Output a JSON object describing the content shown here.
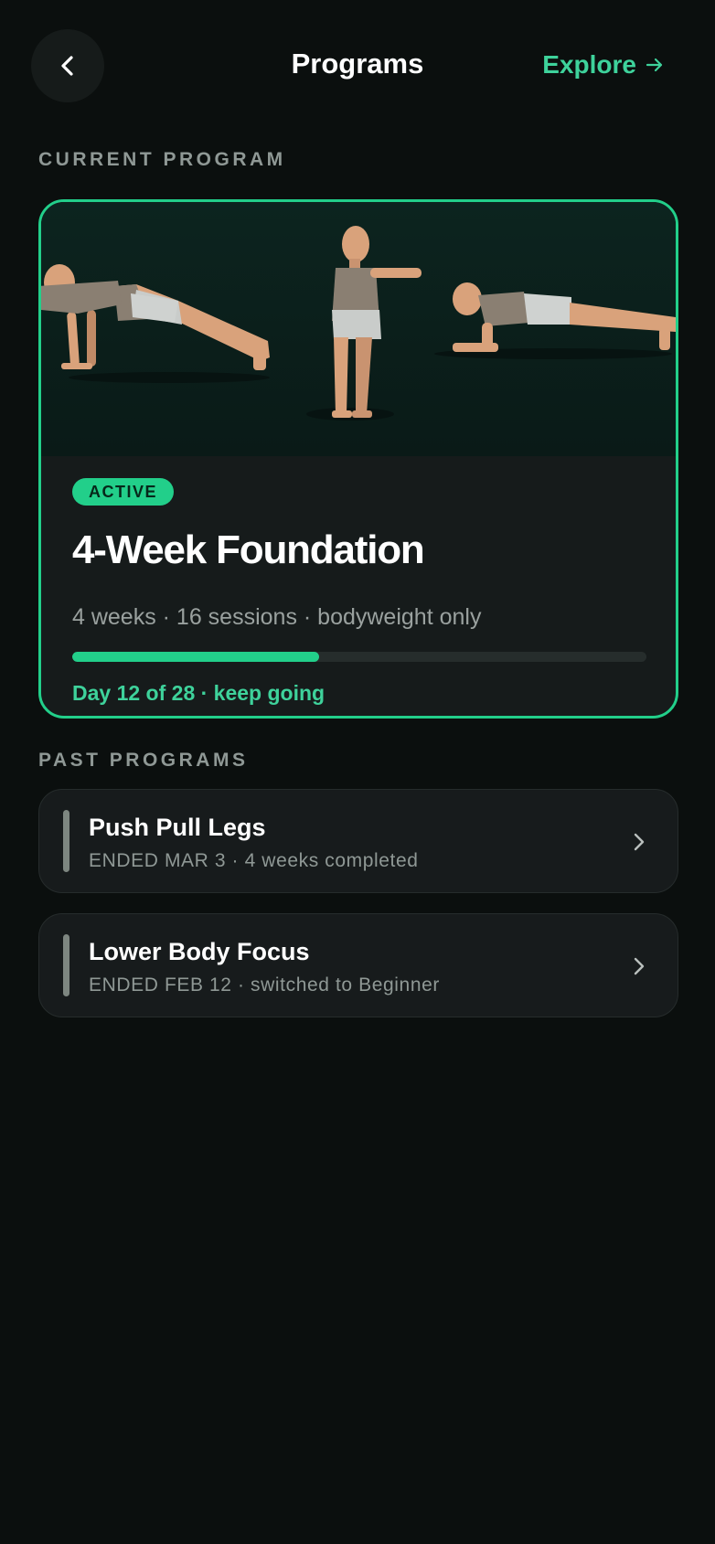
{
  "header": {
    "back_icon": "chevron-left-icon",
    "title": "Programs",
    "explore_label": "Explore",
    "explore_icon": "arrow-right-icon"
  },
  "current_section": {
    "label": "CURRENT PROGRAM",
    "program": {
      "badge": "ACTIVE",
      "name": "4-Week Foundation",
      "meta": "4 weeks · 16 sessions · bodyweight only",
      "progress_fraction": 0.43,
      "progress_text": "Day 12 of 28 · keep going",
      "hero_exercises": [
        "push-up",
        "squat",
        "plank"
      ]
    }
  },
  "past_section": {
    "label": "PAST PROGRAMS",
    "items": [
      {
        "title": "Push Pull Legs",
        "subtitle": "ENDED MAR 3 · 4 weeks completed",
        "icon": "chevron-right-icon"
      },
      {
        "title": "Lower Body Focus",
        "subtitle": "ENDED FEB 12 · switched to Beginner",
        "icon": "chevron-right-icon"
      }
    ]
  },
  "colors": {
    "background": "#0b0f0e",
    "accent": "#22cf8a",
    "accent_text": "#3ed29b",
    "card": "#171b1c",
    "muted_text": "#8f9895"
  }
}
